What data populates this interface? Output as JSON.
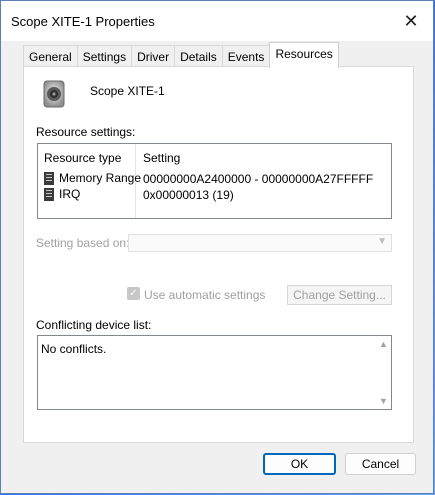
{
  "window": {
    "title": "Scope XITE-1 Properties",
    "close_icon": "close-icon"
  },
  "tabs": [
    {
      "label": "General",
      "active": false
    },
    {
      "label": "Settings",
      "active": false
    },
    {
      "label": "Driver",
      "active": false
    },
    {
      "label": "Details",
      "active": false
    },
    {
      "label": "Events",
      "active": false
    },
    {
      "label": "Resources",
      "active": true
    }
  ],
  "device": {
    "name": "Scope XITE-1",
    "icon": "speaker-icon"
  },
  "resources": {
    "label": "Resource settings:",
    "headers": {
      "type": "Resource type",
      "setting": "Setting"
    },
    "rows": [
      {
        "type": "Memory Range",
        "setting": "00000000A2400000 - 00000000A27FFFFF",
        "icon": "chip-icon"
      },
      {
        "type": "IRQ",
        "setting": "0x00000013 (19)",
        "icon": "chip-icon"
      }
    ]
  },
  "setting_based_on": {
    "label": "Setting based on:",
    "value": ""
  },
  "auto_settings": {
    "label": "Use automatic settings",
    "checked": true,
    "enabled": false
  },
  "change_setting": {
    "label": "Change Setting..."
  },
  "conflicts": {
    "label": "Conflicting device list:",
    "text": "No conflicts."
  },
  "buttons": {
    "ok": "OK",
    "cancel": "Cancel"
  },
  "colors": {
    "accent": "#0067c0",
    "desktop": "#2f6be8"
  }
}
